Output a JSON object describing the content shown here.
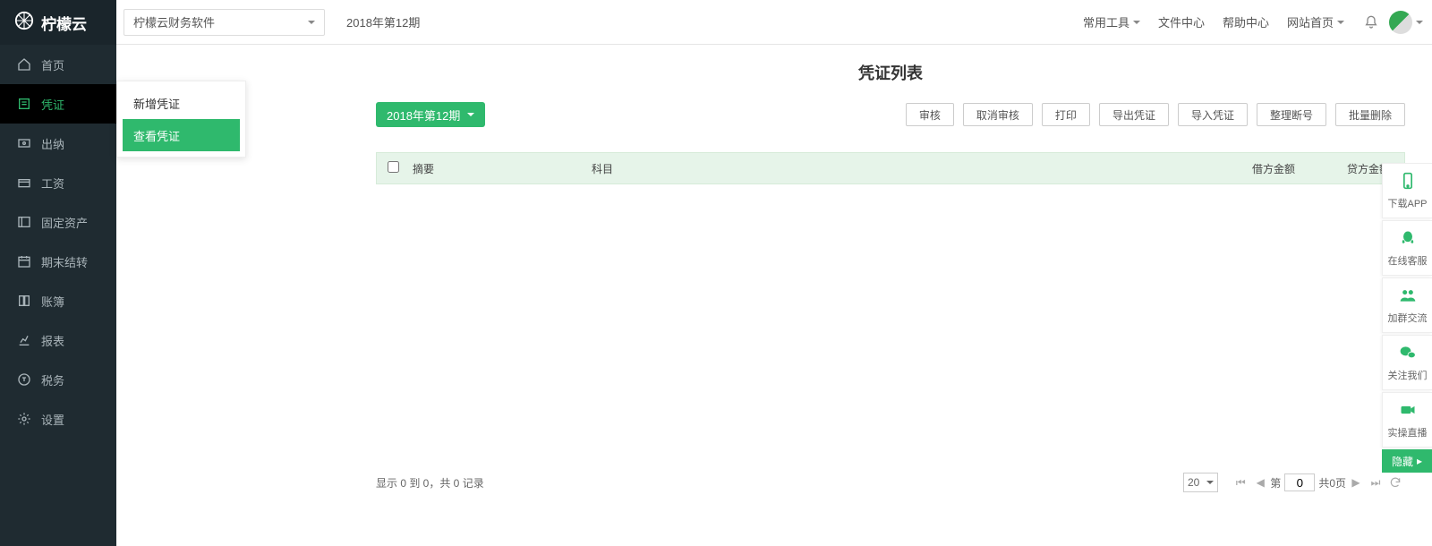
{
  "app": {
    "name": "柠檬云"
  },
  "topbar": {
    "org": "柠檬云财务软件",
    "period": "2018年第12期",
    "links": {
      "tools": "常用工具",
      "files": "文件中心",
      "help": "帮助中心",
      "home": "网站首页"
    }
  },
  "sidebar": {
    "items": [
      {
        "label": "首页"
      },
      {
        "label": "凭证"
      },
      {
        "label": "出纳"
      },
      {
        "label": "工资"
      },
      {
        "label": "固定资产"
      },
      {
        "label": "期末结转"
      },
      {
        "label": "账簿"
      },
      {
        "label": "报表"
      },
      {
        "label": "税务"
      },
      {
        "label": "设置"
      }
    ]
  },
  "flyout": {
    "items": [
      {
        "label": "新增凭证"
      },
      {
        "label": "查看凭证"
      }
    ]
  },
  "page": {
    "title": "凭证列表",
    "period_button": "2018年第12期",
    "actions": {
      "audit": "审核",
      "unaudit": "取消审核",
      "print": "打印",
      "export": "导出凭证",
      "import": "导入凭证",
      "reseq": "整理断号",
      "batch_delete": "批量删除"
    },
    "columns": {
      "summary": "摘要",
      "account": "科目",
      "debit": "借方金额",
      "credit": "贷方金额"
    }
  },
  "pager": {
    "info": "显示 0 到 0，共 0 记录",
    "page_size": "20",
    "page_label_prefix": "第",
    "page_value": "0",
    "page_label_suffix": "共0页"
  },
  "dock": {
    "app": "下载APP",
    "service": "在线客服",
    "group": "加群交流",
    "follow": "关注我们",
    "live": "实操直播",
    "hide": "隐藏"
  }
}
